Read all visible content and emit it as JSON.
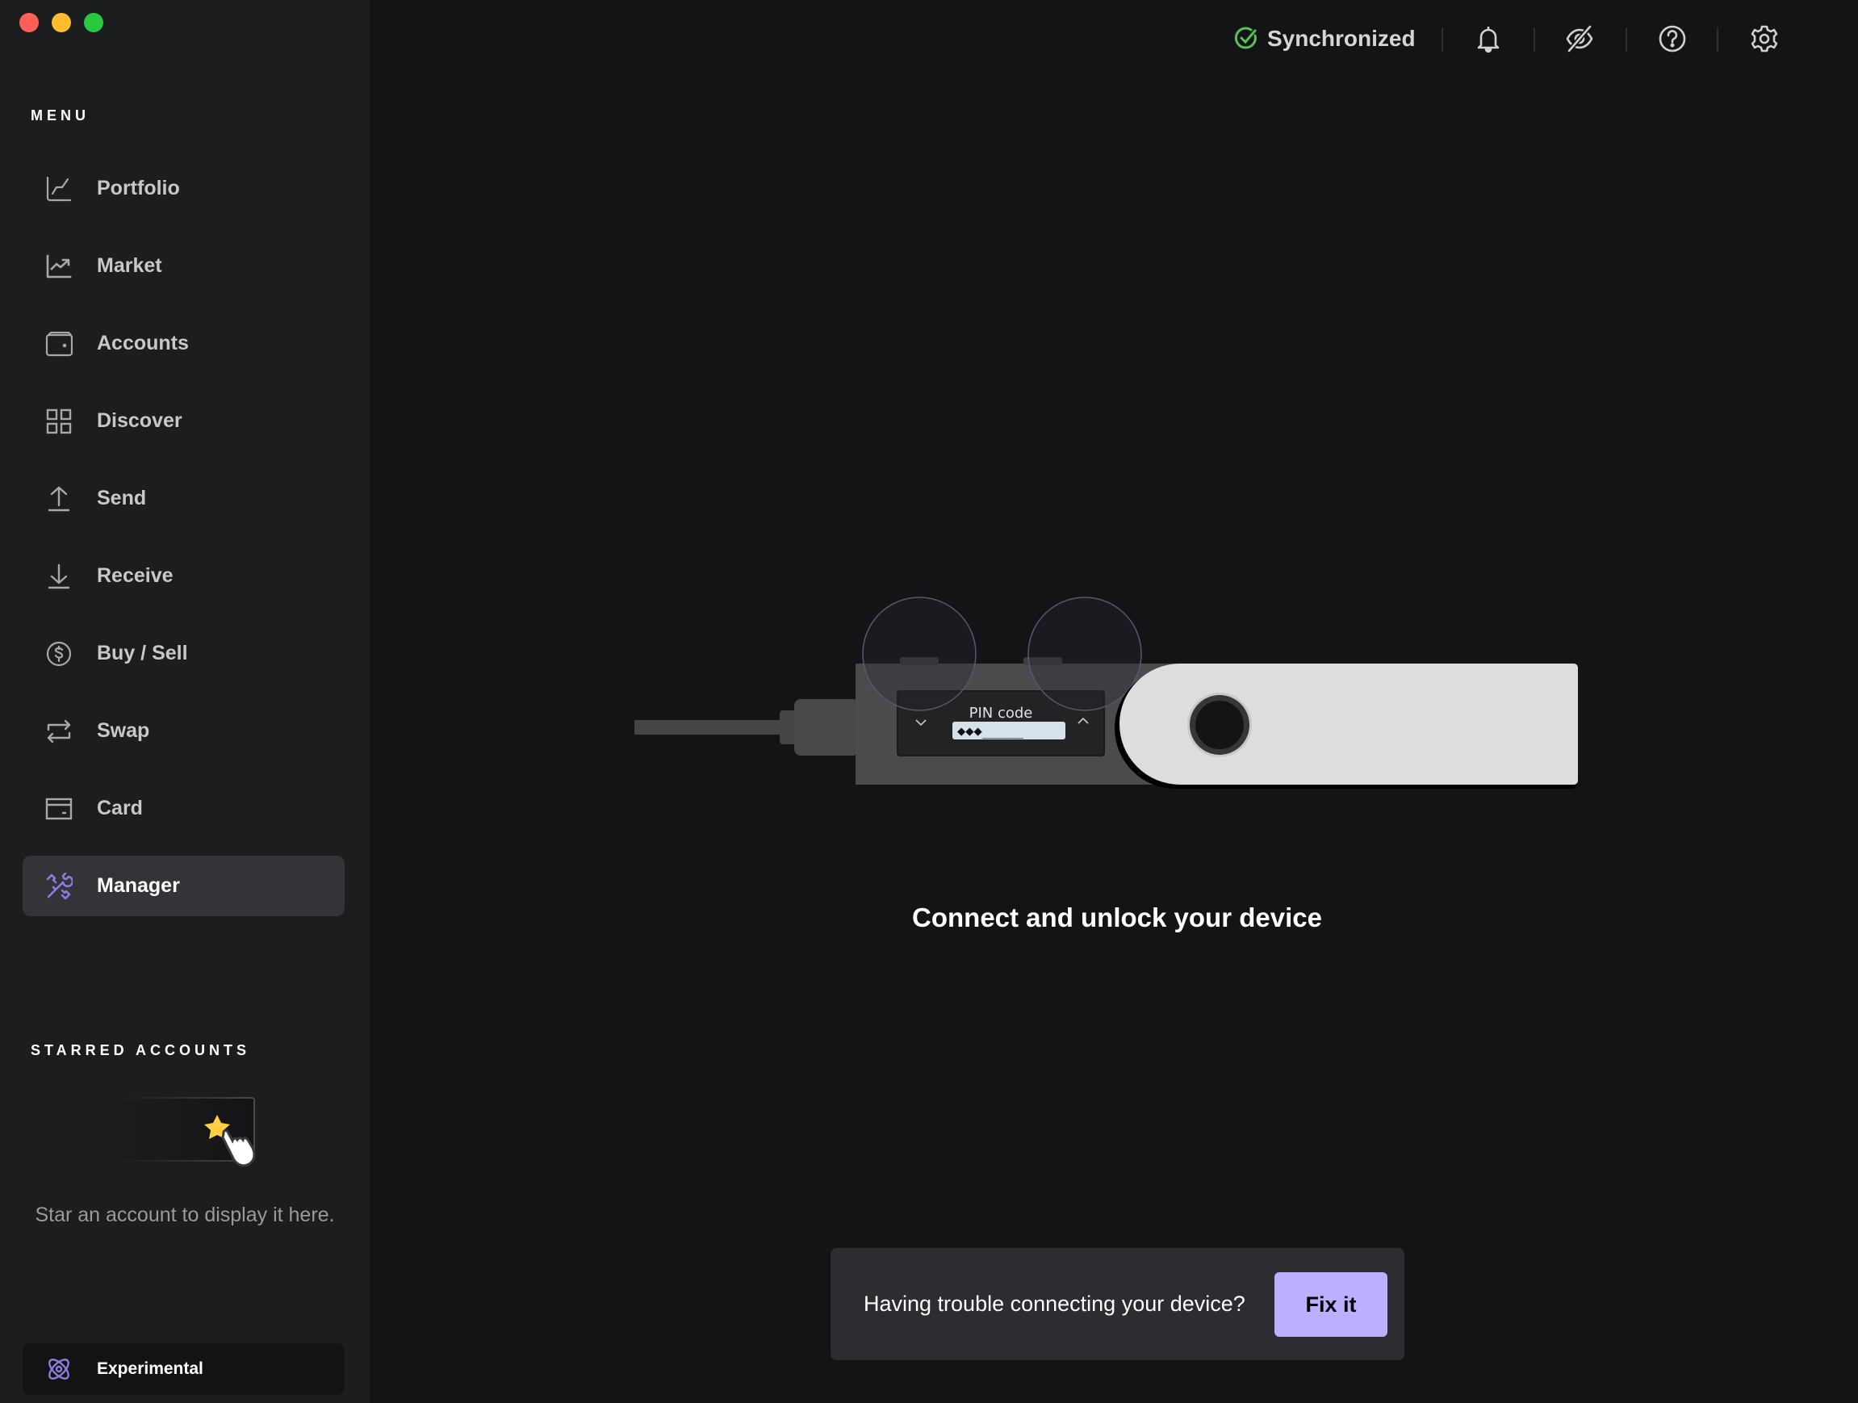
{
  "window": {
    "controls": [
      "close",
      "minimize",
      "maximize"
    ]
  },
  "sidebar": {
    "menu_label": "MENU",
    "items": [
      {
        "label": "Portfolio",
        "icon": "chart-line-icon",
        "active": false
      },
      {
        "label": "Market",
        "icon": "trending-chart-icon",
        "active": false
      },
      {
        "label": "Accounts",
        "icon": "wallet-icon",
        "active": false
      },
      {
        "label": "Discover",
        "icon": "grid-icon",
        "active": false
      },
      {
        "label": "Send",
        "icon": "upload-arrow-icon",
        "active": false
      },
      {
        "label": "Receive",
        "icon": "download-arrow-icon",
        "active": false
      },
      {
        "label": "Buy / Sell",
        "icon": "dollar-circle-icon",
        "active": false
      },
      {
        "label": "Swap",
        "icon": "swap-arrows-icon",
        "active": false
      },
      {
        "label": "Card",
        "icon": "card-icon",
        "active": false
      },
      {
        "label": "Manager",
        "icon": "tools-icon",
        "active": true
      }
    ],
    "starred_label": "STARRED ACCOUNTS",
    "starred_empty_text": "Star an account to display it here.",
    "experimental_label": "Experimental"
  },
  "header": {
    "sync_status": "Synchronized",
    "icons": [
      "bell-icon",
      "eye-off-icon",
      "help-icon",
      "settings-icon"
    ]
  },
  "main": {
    "device_screen_title": "PIN code",
    "device_pin_display": "◆◆◆_____",
    "prompt": "Connect and unlock your device",
    "trouble_text": "Having trouble connecting your device?",
    "fix_button": "Fix it"
  },
  "colors": {
    "accent": "#bbb0ff",
    "accent_icon": "#8a7ee0",
    "success": "#5bbf59",
    "star": "#ffcf44"
  }
}
